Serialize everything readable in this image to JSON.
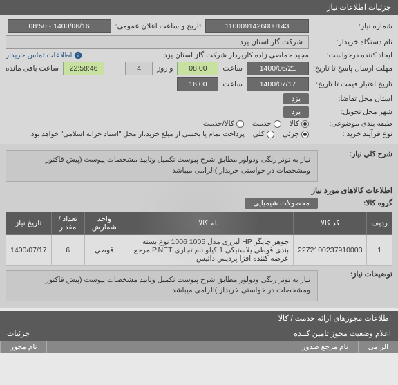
{
  "sections": {
    "info_header": "جزئیات اطلاعات نیاز"
  },
  "fields": {
    "need_no_lbl": "شماره نیاز:",
    "need_no": "1100091426000143",
    "public_time_lbl": "تاریخ و ساعت اعلان عمومی:",
    "public_time": "1400/06/16 - 08:50",
    "buyer_org_lbl": "نام دستگاه خریدار:",
    "buyer_org": "شرکت گاز استان یزد",
    "creator_lbl": "ایجاد کننده درخواست:",
    "creator": "مجید حماصی زاده کارپرداز شرکت گاز استان یزد",
    "contact_lbl": "اطلاعات تماس خریدار",
    "send_deadline_lbl": "مهلت ارسال پاسخ تا تاریخ:",
    "send_date": "1400/06/21",
    "hour_lbl": "ساعت",
    "send_hour": "08:00",
    "day_lbl": "و روز",
    "days": "4",
    "remain_lbl": "ساعت باقی مانده",
    "remain": "22:58:46",
    "validity_lbl": "تاریخ اعتبار قیمت تا تاریخ:",
    "validity_date": "1400/07/17",
    "validity_hour": "16:00",
    "req_city_lbl": "استان محل تقاضا:",
    "req_city": "یزد",
    "deliv_city_lbl": "شهر محل تحویل:",
    "deliv_city": "یزد",
    "category_lbl": "طبقه بندی موضوعی:",
    "buy_type_lbl": "نوع فرآیند خرید :",
    "radios": {
      "kala": "کالا",
      "khadamat": "خدمت",
      "kala_khadamat": "کالا/خدمت",
      "jozi": "جزئی",
      "koli": "کلی"
    },
    "buy_note": "پرداخت تمام یا بخشی از مبلغ خرید،از محل \"اسناد خزانه اسلامی\" خواهد بود."
  },
  "need_summary": {
    "main_lbl": "شرح كلي نیاز:",
    "main_text": "نیاز به تونر رنگی ودولور مطابق شرح پیوست تکمیل وتایید مشخصات پیوست (پیش فاکتور ومشخصات در خواستی خریدار )الزامی میباشد",
    "goods_header": "اطلاعات کالاهای مورد نیاز",
    "group_lbl": "گروه کالا:",
    "group_val": "محصولات شیمیایی"
  },
  "table": {
    "headers": [
      "ردیف",
      "کد کالا",
      "نام کالا",
      "واحد شمارش",
      "تعداد / مقدار",
      "تاریخ نیاز"
    ],
    "rows": [
      {
        "idx": "1",
        "code": "2272100237910003",
        "name": "جوهر چاپگر HP لیزری مدل 1005 1006 نوع بسته بندی قوطی پلاستیکی 1 کیلو نام تجاری P.NET مرجع عرضه کننده افزا پردیس داتیس",
        "unit": "قوطی",
        "qty": "6",
        "date": "1400/07/17"
      }
    ]
  },
  "explain": {
    "lbl": "توضیحات نیاز:",
    "text": "نیاز به تونر رنگی ودولور مطابق شرح پیوست تکمیل وتایید مشخصات پیوست (پیش فاکتور ومشخصات در خواستی خریدار )الزامی میباشد"
  },
  "perm_header": "اطلاعات مجوزهای ارائه خدمت / کالا",
  "bottom": {
    "title": "اعلام وضعیت مجوز تامین کننده",
    "details": "جزئیات",
    "mandatory": "الزامی",
    "ref": "نام مرجع صدور",
    "perm": "نام مجوز"
  }
}
